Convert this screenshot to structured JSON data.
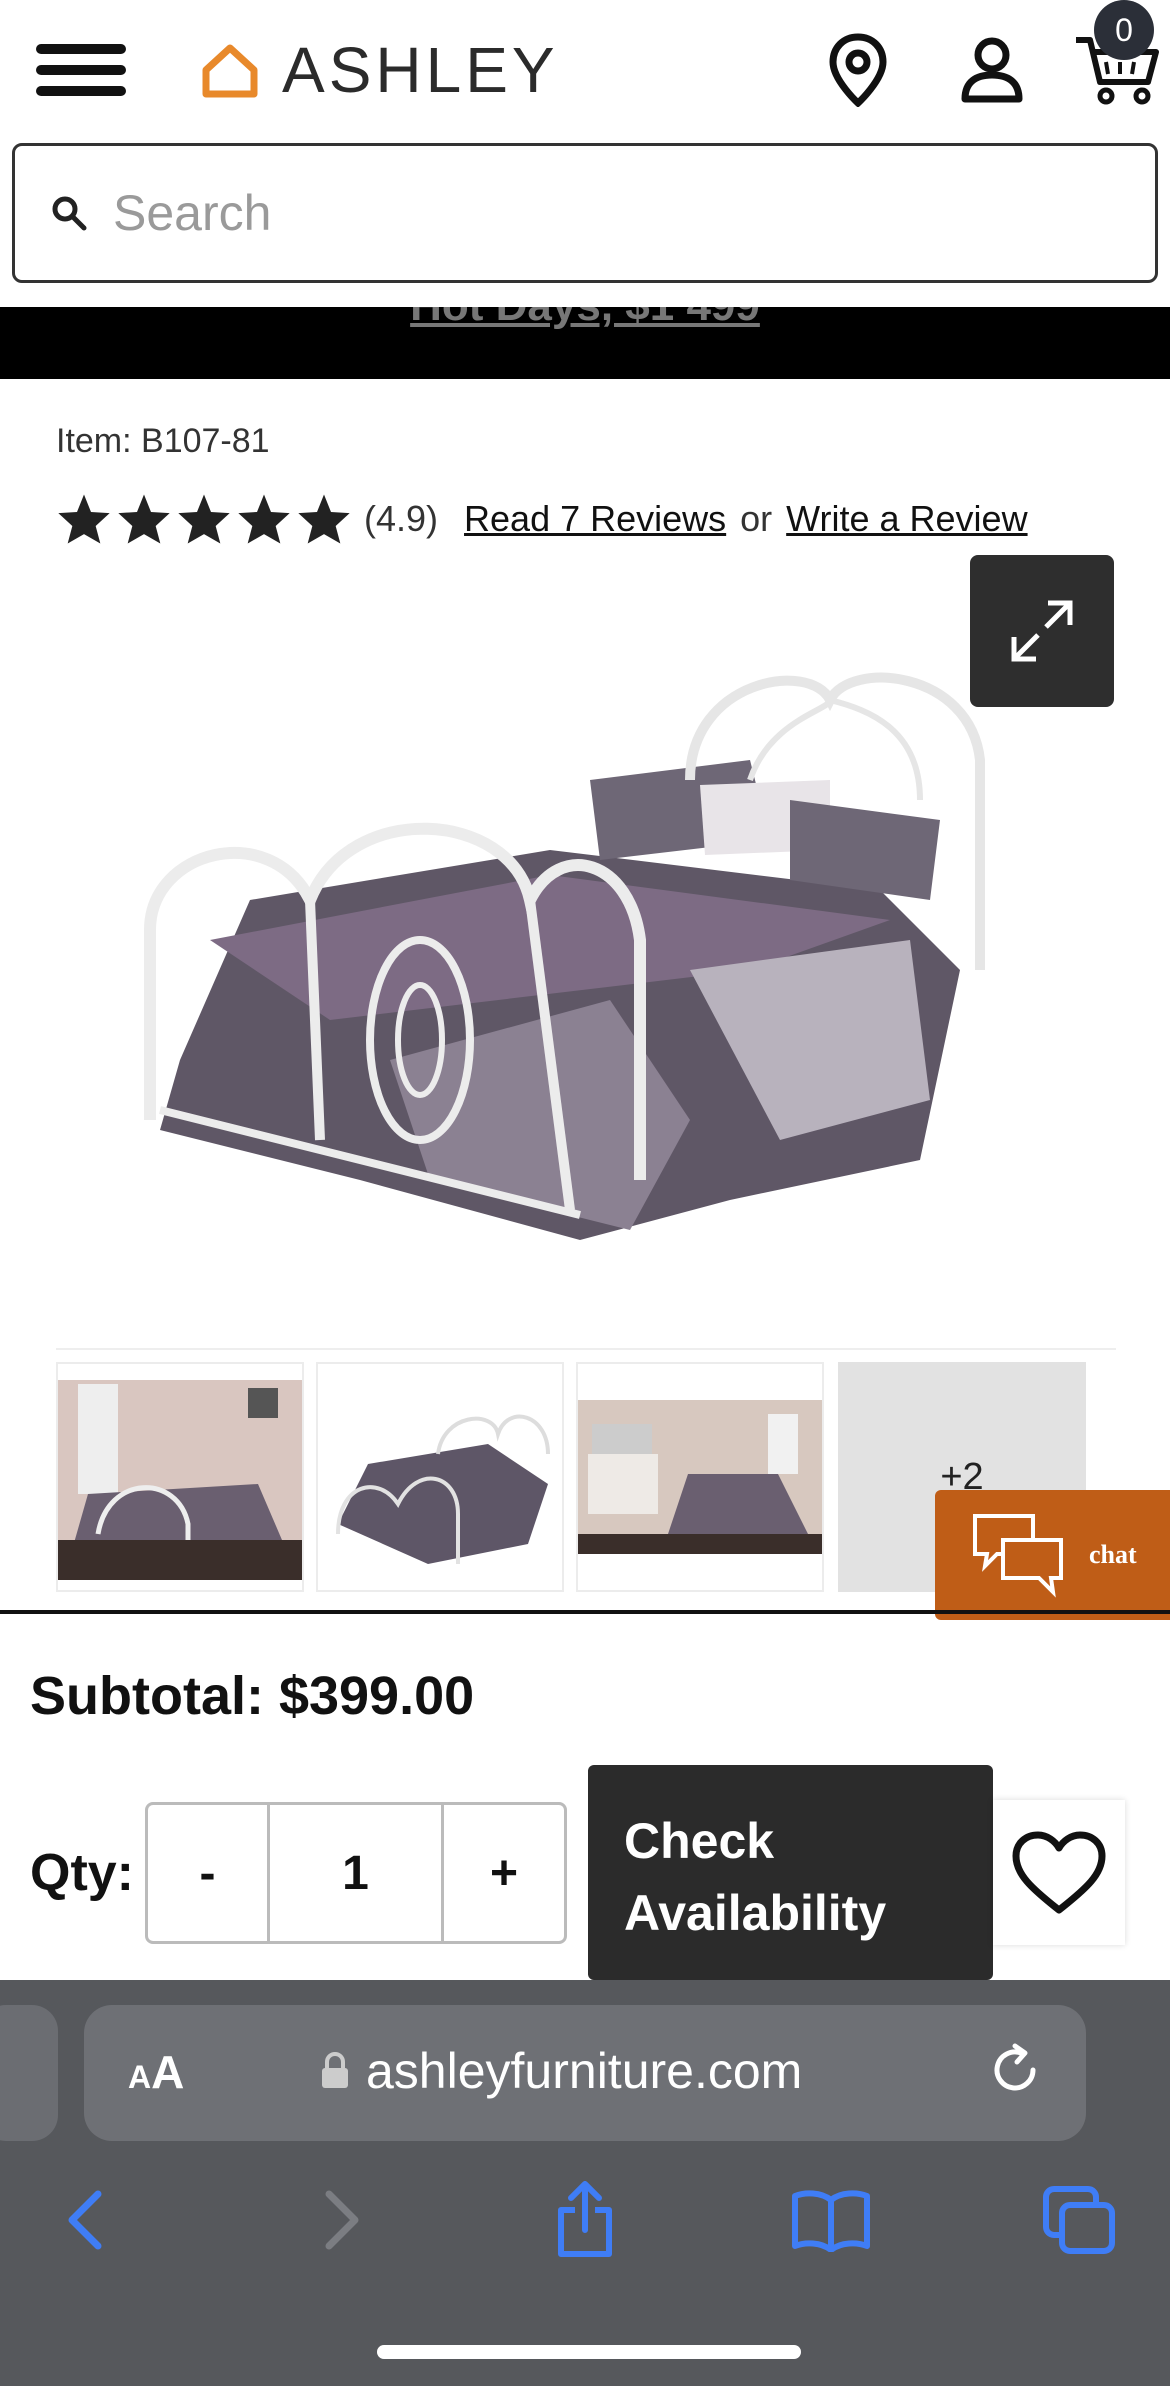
{
  "header": {
    "brand": "ASHLEY",
    "cart_count": "0"
  },
  "search": {
    "placeholder": "Search"
  },
  "banner": {
    "text": "Hot Days, $1 499"
  },
  "product": {
    "item_number": "Item: B107-81",
    "rating_text": "(4.9)",
    "rating_value": 4.9,
    "rating_max": 5,
    "read_reviews": "Read 7 Reviews",
    "or_text": "or",
    "write_review": "Write a Review",
    "more_images": "+2"
  },
  "chat": {
    "label": "chat"
  },
  "purchase": {
    "subtotal": "Subtotal: $399.00",
    "qty_label": "Qty:",
    "qty_minus": "-",
    "qty_value": "1",
    "qty_plus": "+",
    "check_line1": "Check",
    "check_line2": "Availability"
  },
  "browser": {
    "aa_big": "A",
    "aa_small": "A",
    "url": "ashleyfurniture.com"
  },
  "colors": {
    "accent_orange": "#e8892b",
    "chat_bg": "#bf5d17",
    "ios_blue": "#3f7df6",
    "dark_button": "#2b2b2b"
  }
}
